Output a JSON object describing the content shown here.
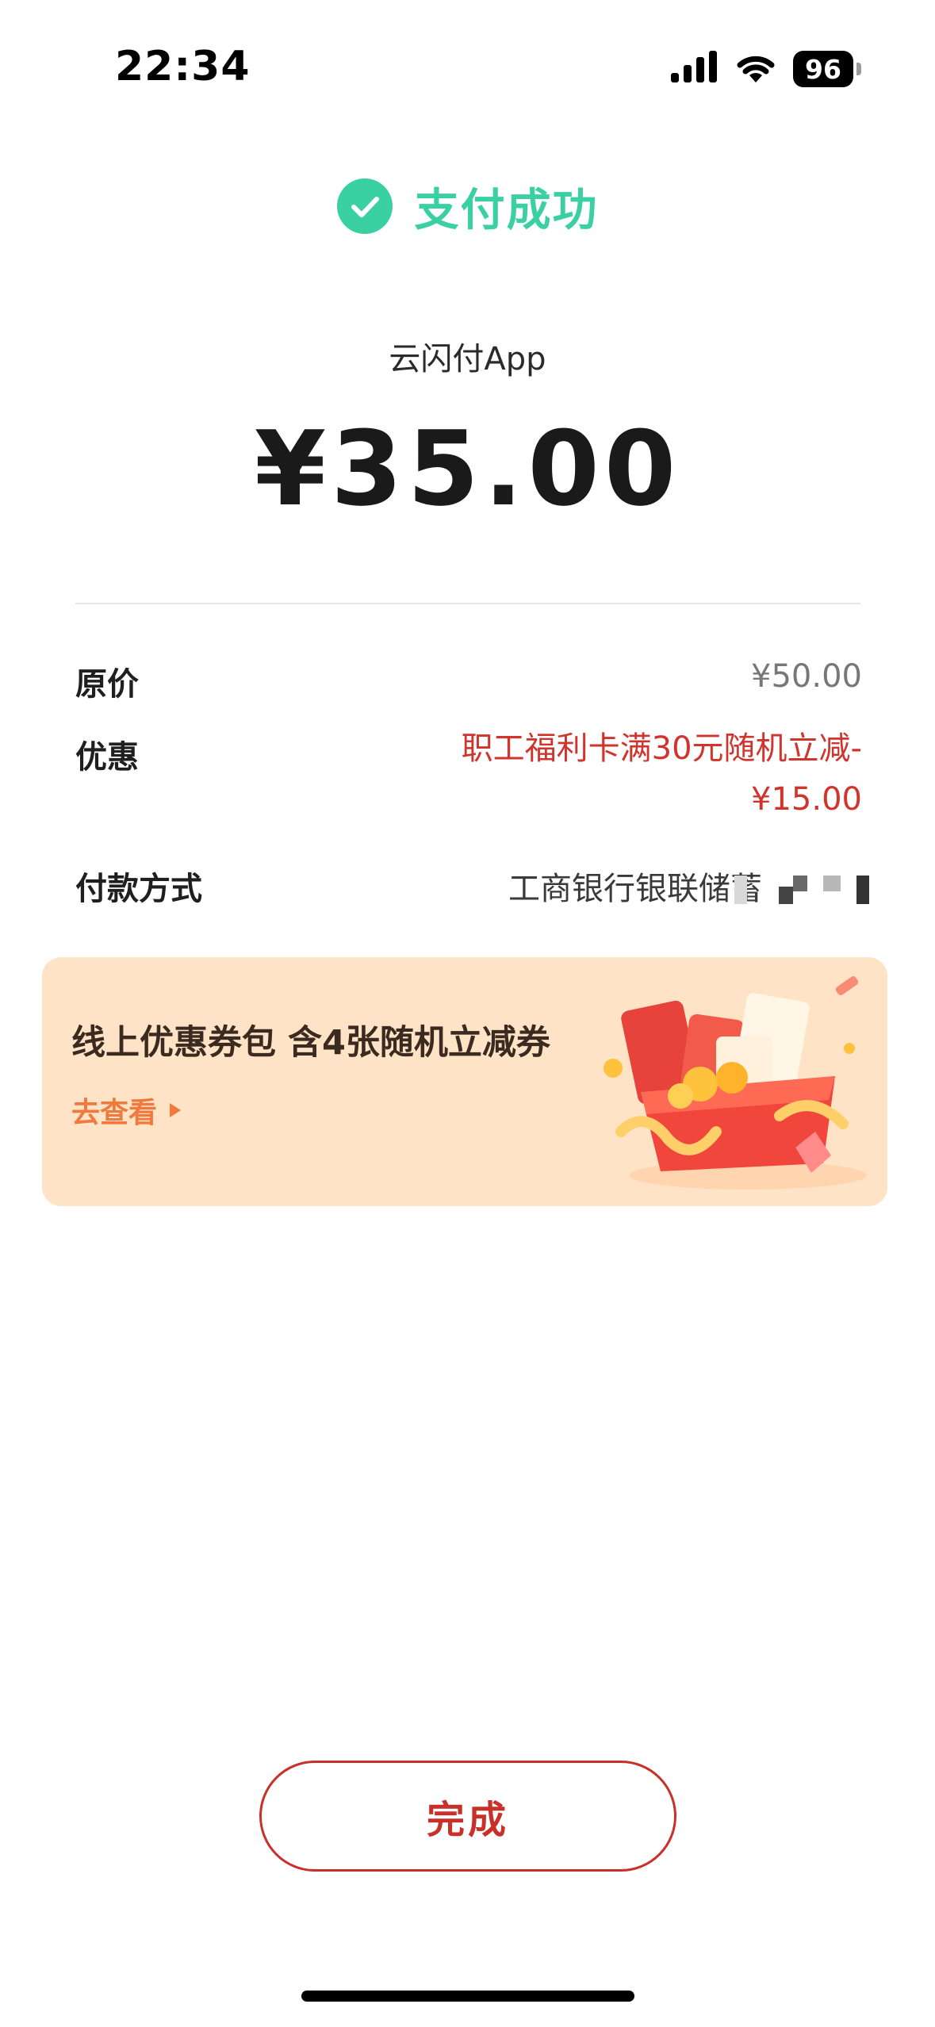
{
  "status_bar": {
    "time": "22:34",
    "battery": "96"
  },
  "header": {
    "success_text": "支付成功",
    "success_color": "#3ad0a2"
  },
  "merchant": "云闪付App",
  "amount": "¥35.00",
  "details": {
    "original_price": {
      "label": "原价",
      "value": "¥50.00"
    },
    "discount": {
      "label": "优惠",
      "value_line1": "职工福利卡满30元随机立减-",
      "value_line2": "¥15.00"
    },
    "payment_method": {
      "label": "付款方式",
      "value": "工商银行银联储蓄"
    }
  },
  "coupon": {
    "title": "线上优惠券包 含4张随机立减券",
    "link": "去查看",
    "background": "#ffe3c7"
  },
  "done_button": {
    "label": "完成",
    "color": "#c8302a"
  }
}
